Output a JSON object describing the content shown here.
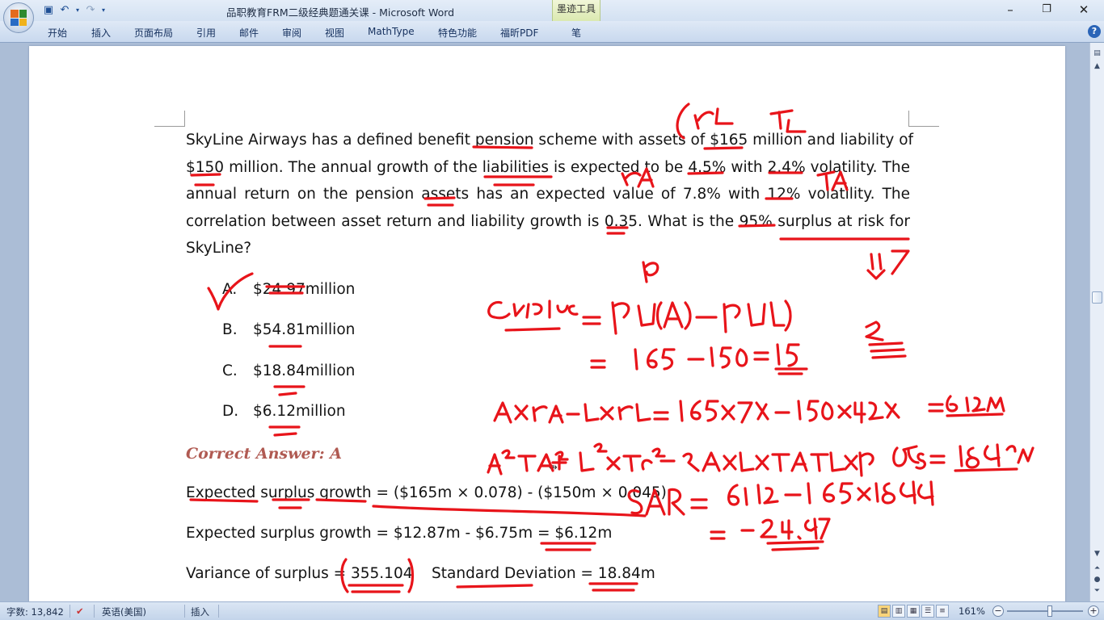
{
  "app": {
    "title": "品职教育FRM二级经典题通关课 - Microsoft Word",
    "context_tab": "墨迹工具",
    "window_controls": {
      "minimize": "–",
      "restore": "❐",
      "close": "✕"
    },
    "quick_access": [
      "save-icon",
      "undo-icon",
      "redo-icon",
      "customize-icon"
    ]
  },
  "ribbon": {
    "tabs": [
      "开始",
      "插入",
      "页面布局",
      "引用",
      "邮件",
      "审阅",
      "视图",
      "MathType",
      "特色功能",
      "福昕PDF",
      "笔"
    ],
    "help": "?"
  },
  "document": {
    "question_lines": [
      "SkyLine Airways has a defined benefit pension scheme with assets of $165 million and liability of",
      "$150 million. The annual growth of the liabilities is expected to be 4.5% with 2.4% volatility. The",
      "annual return on the pension assets has an expected value of 7.8% with 12% volatility. The",
      "correlation between asset return and liability growth is 0.35. What is the 95% surplus at risk for",
      "SkyLine?"
    ],
    "options": [
      {
        "label": "A.",
        "text": "$24.97million"
      },
      {
        "label": "B.",
        "text": "$54.81million"
      },
      {
        "label": "C.",
        "text": "$18.84million"
      },
      {
        "label": "D.",
        "text": "$6.12million"
      }
    ],
    "correct_answer": "Correct Answer: A",
    "calculations": [
      "Expected surplus growth = ($165m × 0.078) - ($150m × 0.045)",
      "Expected surplus growth = $12.87m - $6.75m = $6.12m",
      "Variance of surplus = 355.104    Standard Deviation = 18.84m"
    ]
  },
  "statusbar": {
    "word_count": "字数: 13,842",
    "language": "英语(美国)",
    "mode": "插入",
    "zoom": "161%",
    "zoom_level_percent": 161
  },
  "colors": {
    "ink": "#e8141a",
    "correct_answer": "#b05a52",
    "ribbon_text": "#15305e"
  }
}
